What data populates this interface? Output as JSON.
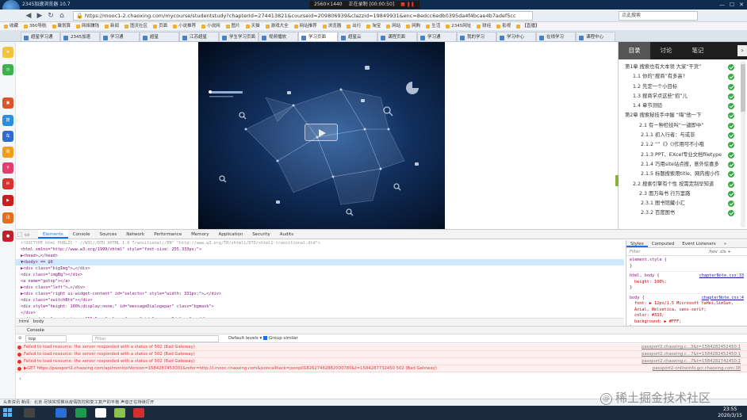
{
  "browser": {
    "window_title": "2345加速浏览器 10.7",
    "recording": {
      "resolution": "2560×1440",
      "status": "正在录制 [00:00:50]"
    },
    "url": "https://mooc1-2.chaoxing.com/mycourse/studentstudy?chapterId=274413821&courseid=209806939&clazzid=19849931&enc=8edcc6edb0395da4f4bcae4b7adef5cc",
    "search_placeholder": "点此搜索",
    "bookmarks": [
      "收藏",
      "360导航",
      "聚划算",
      "网络赚钱",
      "新闻",
      "图灵社区",
      "页面",
      "小说推荐",
      "小说网",
      "图片",
      "天猫",
      "游戏大全",
      "网站推荐",
      "浏览器",
      "出行",
      "淘宝",
      "网站",
      "网购",
      "生活",
      "2345网址",
      "财经",
      "影视",
      "【直播】"
    ],
    "tabs": [
      "超星学习通",
      "2345加速",
      "学习通",
      "超星",
      "江苏超星",
      "学生学习页面",
      "视频播放",
      "学习页面",
      "超星云",
      "课程页面",
      "学习通",
      "我的学习",
      "学习中心",
      "在线学习",
      "课程中心"
    ]
  },
  "sidebar_icons": [
    "favorites",
    "history",
    "games",
    "search",
    "cars",
    "shopping",
    "finance",
    "mail",
    "video",
    "news"
  ],
  "course_panel": {
    "tabs": [
      "目录",
      "讨论",
      "笔记"
    ],
    "items": [
      {
        "label": "第1章 搜索也有大本领 大家“干货”",
        "level": "chap"
      },
      {
        "label": "1.1 你的“搜商”有多高?",
        "level": "sec"
      },
      {
        "label": "1.2 先定一个小目标",
        "level": "sec"
      },
      {
        "label": "1.3 搜商学点这些“招”儿",
        "level": "sec"
      },
      {
        "label": "1.4 章节测验",
        "level": "sec"
      },
      {
        "label": "第2章 搜索秘技手中握 “嗨”他一下",
        "level": "chap"
      },
      {
        "label": "2.1 有一种检技叫“一键即中”",
        "level": "sub"
      },
      {
        "label": "2.1.1 初入行者：与或非",
        "level": "subsub"
      },
      {
        "label": "2.1.2 “”《》()作用可不小哦",
        "level": "subsub"
      },
      {
        "label": "2.1.3 PPT、EXcel专业文档filetype",
        "level": "subsub"
      },
      {
        "label": "2.1.4 巧用site站点搜，意外惊喜多",
        "level": "subsub"
      },
      {
        "label": "2.1.5 标题搜索用title、网内搜小作",
        "level": "subsub"
      },
      {
        "label": "2.2 搜索引擎有个性 按需定制早知道",
        "level": "sec"
      },
      {
        "label": "2.3 面万每书 行万里路",
        "level": "sub"
      },
      {
        "label": "2.3.1 图书馆藏小汇",
        "level": "subsub"
      },
      {
        "label": "2.3.2 百度图书",
        "level": "subsub"
      }
    ]
  },
  "devtools": {
    "tabs": [
      "Elements",
      "Console",
      "Sources",
      "Network",
      "Performance",
      "Memory",
      "Application",
      "Security",
      "Audits"
    ],
    "dom_lines": [
      {
        "text": "<!DOCTYPE html PUBLIC \"-//W3C//DTD XHTML 1.0 Transitional//EN\" \"http://www.w3.org/TR/xhtml1/DTD/xhtml1-transitional.dtd\">",
        "kind": "comment",
        "selected": false
      },
      {
        "text": "<html xmlns=\"http://www.w3.org/1999/xhtml\" style=\"font-size: 255.333px;\">",
        "kind": "tag",
        "selected": false
      },
      {
        "text": "  ▶<head>…</head>",
        "kind": "tag",
        "selected": false
      },
      {
        "text": "▼<body> == $0",
        "kind": "tag",
        "selected": true
      },
      {
        "text": "    ▶<div class=\"bigImg\">…</div>",
        "kind": "tag",
        "selected": false
      },
      {
        "text": "      <div class=\"imgBg\"></div>",
        "kind": "tag",
        "selected": false
      },
      {
        "text": "      <a name=\"gotop\"></a>",
        "kind": "tag",
        "selected": false
      },
      {
        "text": "    ▶<div class=\"left\">…</div>",
        "kind": "tag",
        "selected": false
      },
      {
        "text": "    ▶<div class=\"right ui-widget-content\" id=\"selector\" style=\"width: 331px;\">…</div>",
        "kind": "tag",
        "selected": false
      },
      {
        "text": "      <div class=\"switchBtn\"></div>",
        "kind": "tag",
        "selected": false
      },
      {
        "text": "      <div style=\"height: 100%;display:none;\" id=\"messageDialogepar\" class=\"bgmask\">",
        "kind": "tag",
        "selected": false
      },
      {
        "text": "      </div>",
        "kind": "tag",
        "selected": false
      },
      {
        "text": "    ▶<div style=\"margin-top: -255.5px;\" class=\"mypop\" id=\"messageDialoge\">…</div>",
        "kind": "tag",
        "selected": false
      }
    ],
    "breadcrumb": [
      "html",
      "body"
    ],
    "styles_tabs": [
      "Styles",
      "Computed",
      "Event Listeners",
      "»"
    ],
    "styles_filter": "Filter",
    "styles_hov": ":hov  .cls  +",
    "style_rules": [
      {
        "selector": "element.style {",
        "props": [],
        "source": ""
      },
      {
        "selector": "html, body {",
        "props": [
          "height: 100%;"
        ],
        "source": "chapterNote.css:33"
      },
      {
        "selector": "body {",
        "props": [
          "font: ▶ 12px/1.5 Microsoft YaHei,SimSun,",
          "Arial, Helvetica, sans-serif;",
          "color: #333;",
          "background: ▶ #FFF;"
        ],
        "source": "chapterNote.css:4"
      }
    ],
    "console_label": "Console",
    "console_context": "top",
    "console_filter": "Filter",
    "console_levels": "Default levels ▾",
    "console_group": "Group similar",
    "console_lines": [
      {
        "text": "Failed to load resource: the server responded with a status of 502 (Bad Gateway)",
        "src": "passport2.chaoxing.c…3&t=1584282452450:1"
      },
      {
        "text": "Failed to load resource: the server responded with a status of 502 (Bad Gateway)",
        "src": "passport2.chaoxing.c…7&t=1584282452450:1"
      },
      {
        "text": "Failed to load resource: the server responded with a status of 502 (Bad Gateway)",
        "src": "passport2.chaoxing.c…7&t=1584282742450:1"
      },
      {
        "text": "▶GET https://passport2.chaoxing.com/api/monitorVersion=1584287453001&refer=http://i.mooc.chaoxing.com&jsoncallback=jsonp0182627482882000780&t=1584287732450 502 (Bad Gateway)",
        "src": "passport2-onlineinfo.gcr.chaoxing.com:38"
      }
    ]
  },
  "statusbar": "头条资讯   新闻：北京   尽快实现推出疫情防控和复工复产的平衡   声音正在持续打开",
  "clock": {
    "time": "23:55",
    "date": "2020/3/15"
  },
  "watermark": "稀土掘金技术社区"
}
